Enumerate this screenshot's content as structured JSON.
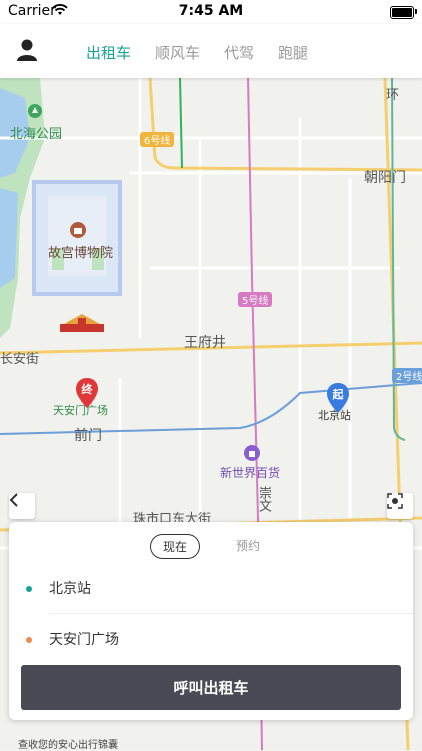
{
  "status_bar": {
    "carrier": "Carrier",
    "time": "7:45 AM"
  },
  "header": {
    "tabs": [
      {
        "label": "出租车",
        "active": true
      },
      {
        "label": "顺风车",
        "active": false
      },
      {
        "label": "代驾",
        "active": false
      },
      {
        "label": "跑腿",
        "active": false
      }
    ]
  },
  "map": {
    "labels": {
      "beihai_park": "北海公园",
      "palace_museum": "故宫博物院",
      "chaoyangmen": "朝阳门",
      "wangfujing": "王府井",
      "changan": "长安街",
      "qianmen": "前门",
      "new_world": "新世界百货",
      "zhushikou": "珠市口东大街",
      "chongwen": "崇文",
      "huan": "环",
      "tiananmen_square": "天安门广场",
      "beijing_station": "北京站"
    },
    "road_badges": {
      "line6": "6号线",
      "line5": "5号线",
      "line2": "2号线"
    },
    "pins": {
      "start": "起",
      "end": "终"
    },
    "colors": {
      "line6": "#f2b53c",
      "line5": "#d77ac3",
      "line2": "#6a9fd9",
      "start_pin": "#3a7be0",
      "end_pin": "#e0383a"
    }
  },
  "card": {
    "time_options": [
      {
        "label": "现在",
        "active": true
      },
      {
        "label": "预约",
        "active": false
      }
    ],
    "origin": "北京站",
    "destination": "天安门广场",
    "origin_dot_color": "#17a394",
    "destination_dot_color": "#f08a4b",
    "call_button": "呼叫出租车"
  },
  "footer_tip": "查收您的安心出行锦囊"
}
